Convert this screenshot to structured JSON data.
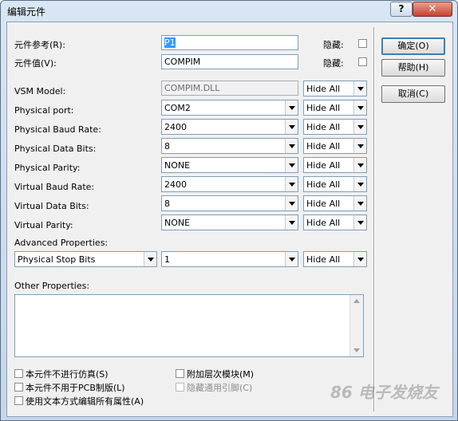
{
  "window": {
    "title": "编辑元件",
    "help": "?",
    "close": "✕"
  },
  "fields": {
    "ref_label": "元件参考(R):",
    "ref_value": "P1",
    "ref_hidden": "隐藏:",
    "val_label": "元件值(V):",
    "val_value": "COMPIM",
    "val_hidden": "隐藏:"
  },
  "properties": [
    {
      "label": "VSM Model:",
      "value": "COMPIM.DLL",
      "vis": "Hide All"
    },
    {
      "label": "Physical port:",
      "value": "COM2",
      "vis": "Hide All"
    },
    {
      "label": "Physical Baud Rate:",
      "value": "2400",
      "vis": "Hide All"
    },
    {
      "label": "Physical Data Bits:",
      "value": "8",
      "vis": "Hide All"
    },
    {
      "label": "Physical Parity:",
      "value": "NONE",
      "vis": "Hide All"
    },
    {
      "label": "Virtual Baud Rate:",
      "value": "2400",
      "vis": "Hide All"
    },
    {
      "label": "Virtual Data Bits:",
      "value": "8",
      "vis": "Hide All"
    },
    {
      "label": "Virtual Parity:",
      "value": "NONE",
      "vis": "Hide All"
    }
  ],
  "advanced": {
    "label": "Advanced Properties:",
    "name": "Physical Stop Bits",
    "value": "1",
    "vis": "Hide All"
  },
  "other_label": "Other Properties:",
  "buttons": {
    "ok": "确定(O)",
    "help": "帮助(H)",
    "cancel": "取消(C)"
  },
  "checks": {
    "no_sim": "本元件不进行仿真(S)",
    "no_pcb": "本元件不用于PCB制版(L)",
    "text_edit": "使用文本方式编辑所有属性(A)",
    "attach_hier": "附加层次模块(M)",
    "hide_pins": "隐藏通用引脚(C)"
  },
  "watermark": "86 电子发烧友"
}
